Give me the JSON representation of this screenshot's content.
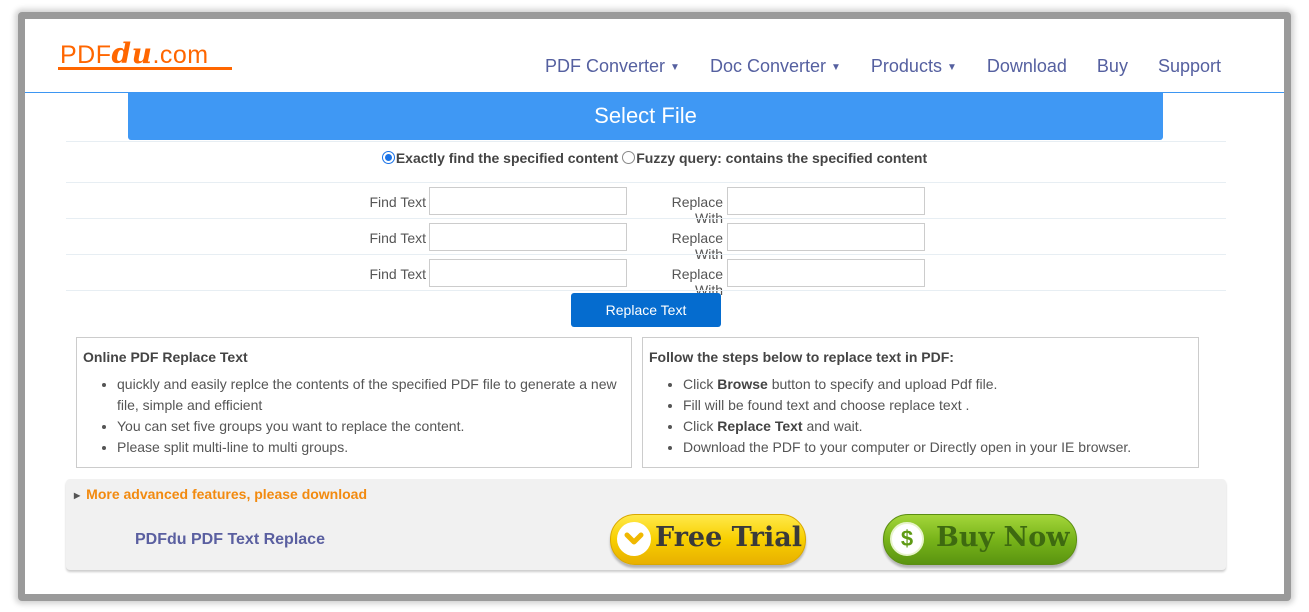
{
  "logo": {
    "prefix": "PDF",
    "du": "du",
    "suffix": ".com"
  },
  "nav": {
    "items": [
      {
        "label": "PDF Converter",
        "dropdown": true
      },
      {
        "label": "Doc Converter",
        "dropdown": true
      },
      {
        "label": "Products",
        "dropdown": true
      },
      {
        "label": "Download",
        "dropdown": false
      },
      {
        "label": "Buy",
        "dropdown": false
      },
      {
        "label": "Support",
        "dropdown": false
      }
    ],
    "caret": "▼"
  },
  "select_file": {
    "label": "Select File"
  },
  "search_mode": {
    "options": [
      {
        "label": "Exactly find the specified content",
        "checked": true
      },
      {
        "label": "Fuzzy query: contains the specified content",
        "checked": false
      }
    ]
  },
  "find_rows": [
    {
      "find_label": "Find Text",
      "find_value": "",
      "replace_label": "Replace With",
      "replace_value": ""
    },
    {
      "find_label": "Find Text",
      "find_value": "",
      "replace_label": "Replace With",
      "replace_value": ""
    },
    {
      "find_label": "Find Text",
      "find_value": "",
      "replace_label": "Replace With",
      "replace_value": ""
    }
  ],
  "replace_button": {
    "label": "Replace Text"
  },
  "info_left": {
    "title": "Online PDF Replace Text",
    "items": [
      "quickly and easily replce the contents of the specified PDF file to generate a new file, simple and efficient",
      "You can set five groups you want to replace the content.",
      "Please split multi-line to multi groups."
    ]
  },
  "info_right": {
    "title": "Follow the steps below to replace text in PDF:",
    "items": [
      {
        "pre": "Click ",
        "bold": "Browse",
        "post": " button to specify and upload Pdf file."
      },
      {
        "pre": "Fill will be found text and choose replace text .",
        "bold": "",
        "post": ""
      },
      {
        "pre": "Click ",
        "bold": "Replace Text",
        "post": " and wait."
      },
      {
        "pre": "Download the PDF to your computer or Directly open in your IE browser.",
        "bold": "",
        "post": ""
      }
    ]
  },
  "promo": {
    "toggle_label": "More advanced features, please download",
    "product_name": "PDFdu PDF Text Replace",
    "free_trial": {
      "label": "Free Trial",
      "icon": "⌄"
    },
    "buy_now": {
      "label": "Buy Now",
      "icon": "$"
    }
  },
  "colors": {
    "brand_orange": "#ff6600",
    "nav_text": "#5560a0",
    "accent_blue": "#3f98f4",
    "button_blue": "#056ccf",
    "promo_orange": "#f28a0f"
  }
}
